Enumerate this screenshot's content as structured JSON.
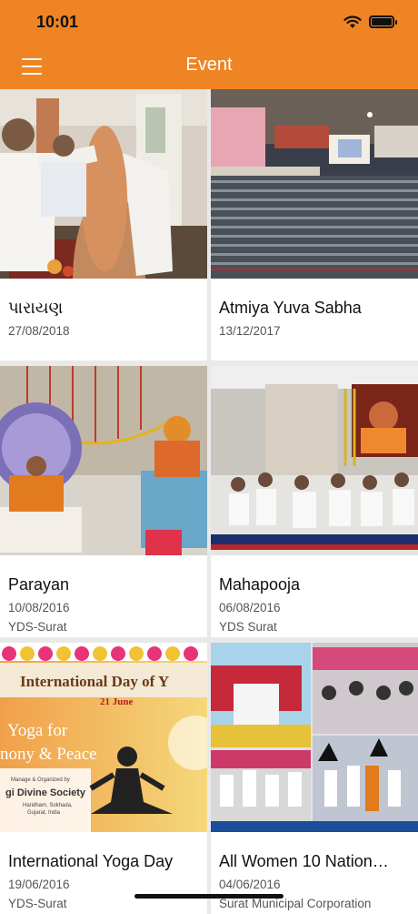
{
  "status_bar": {
    "time": "10:01"
  },
  "header": {
    "title": "Event",
    "menu_icon": "hamburger-icon"
  },
  "colors": {
    "accent": "#ef8424"
  },
  "events": [
    {
      "name": "પારાયણ",
      "date": "27/08/2018",
      "place": ""
    },
    {
      "name": "Atmiya Yuva Sabha",
      "date": "13/12/2017",
      "place": ""
    },
    {
      "name": "Parayan",
      "date": "10/08/2016",
      "place": "YDS-Surat"
    },
    {
      "name": "Mahapooja",
      "date": "06/08/2016",
      "place": "YDS Surat"
    },
    {
      "name": "International Yoga Day",
      "date": "19/06/2016",
      "place": "YDS-Surat"
    },
    {
      "name": "All Women 10 Nation…",
      "date": "04/06/2016",
      "place": "Surat Municipal Corporation"
    }
  ],
  "banner": {
    "line1": "International Day of Y",
    "line2": "21 June",
    "line3": "Yoga for",
    "line4": "nony & Peace",
    "org_small": "Manage & Organized by",
    "org": "gi Divine Society",
    "org_addr1": "Haridham, Sokhada,",
    "org_addr2": "Gujarat, India"
  }
}
